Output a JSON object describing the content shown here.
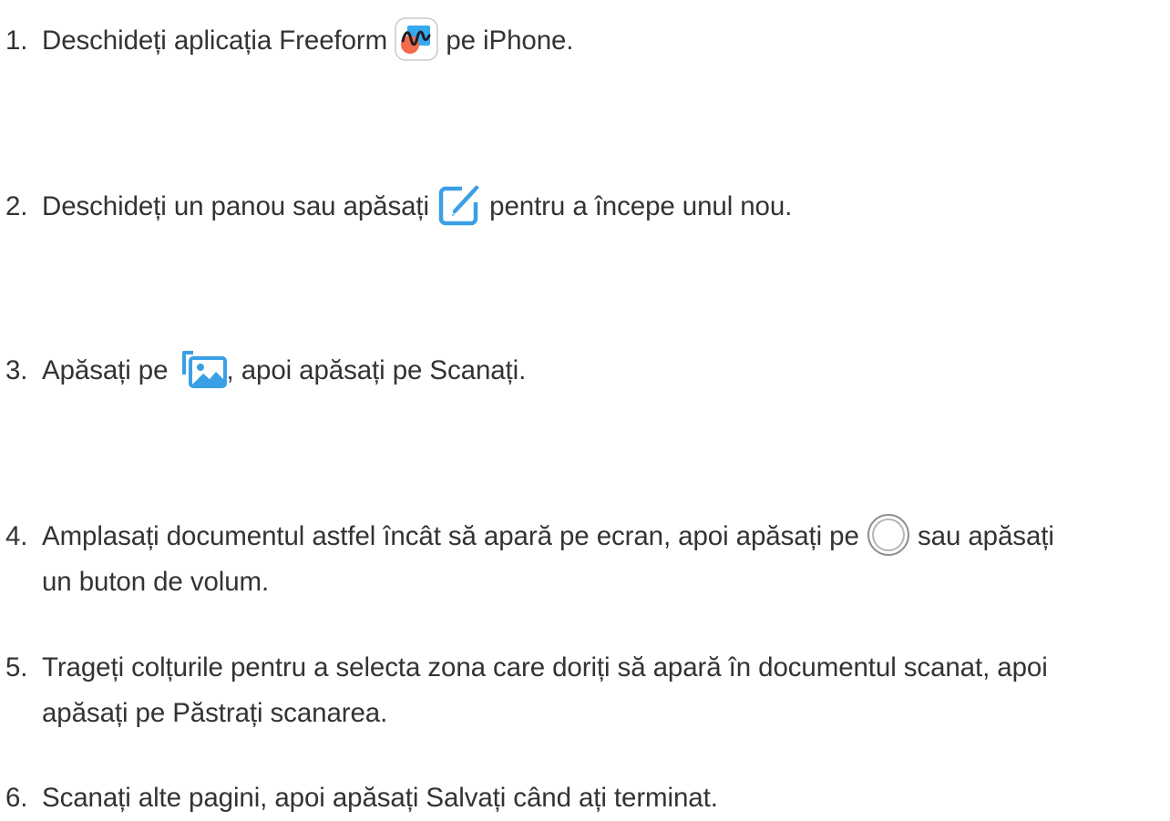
{
  "steps": [
    {
      "number": "1.",
      "before": "Deschideți aplicația Freeform",
      "icon": "freeform-app-icon",
      "after": "pe iPhone."
    },
    {
      "number": "2.",
      "before": "Deschideți un panou sau apăsați",
      "icon": "compose-new-board-icon",
      "after": "pentru a începe unul nou."
    },
    {
      "number": "3.",
      "before": "Apăsați pe",
      "icon": "photos-media-icon",
      "after": ", apoi apăsați pe Scanați."
    },
    {
      "number": "4.",
      "before": "Amplasați documentul astfel încât să apară pe ecran, apoi apăsați pe",
      "icon": "shutter-button-icon",
      "after": "sau apăsați",
      "continuation": "un buton de volum."
    },
    {
      "number": "5.",
      "before": "Trageți colțurile pentru a selecta zona care doriți să apară în documentul scanat, apoi",
      "continuation": "apăsați pe Păstrați scanarea."
    },
    {
      "number": "6.",
      "before": "Scanați alte pagini, apoi apăsați Salvați când ați terminat."
    }
  ],
  "colors": {
    "text": "#333336",
    "accent_blue": "#3aa0e6"
  }
}
